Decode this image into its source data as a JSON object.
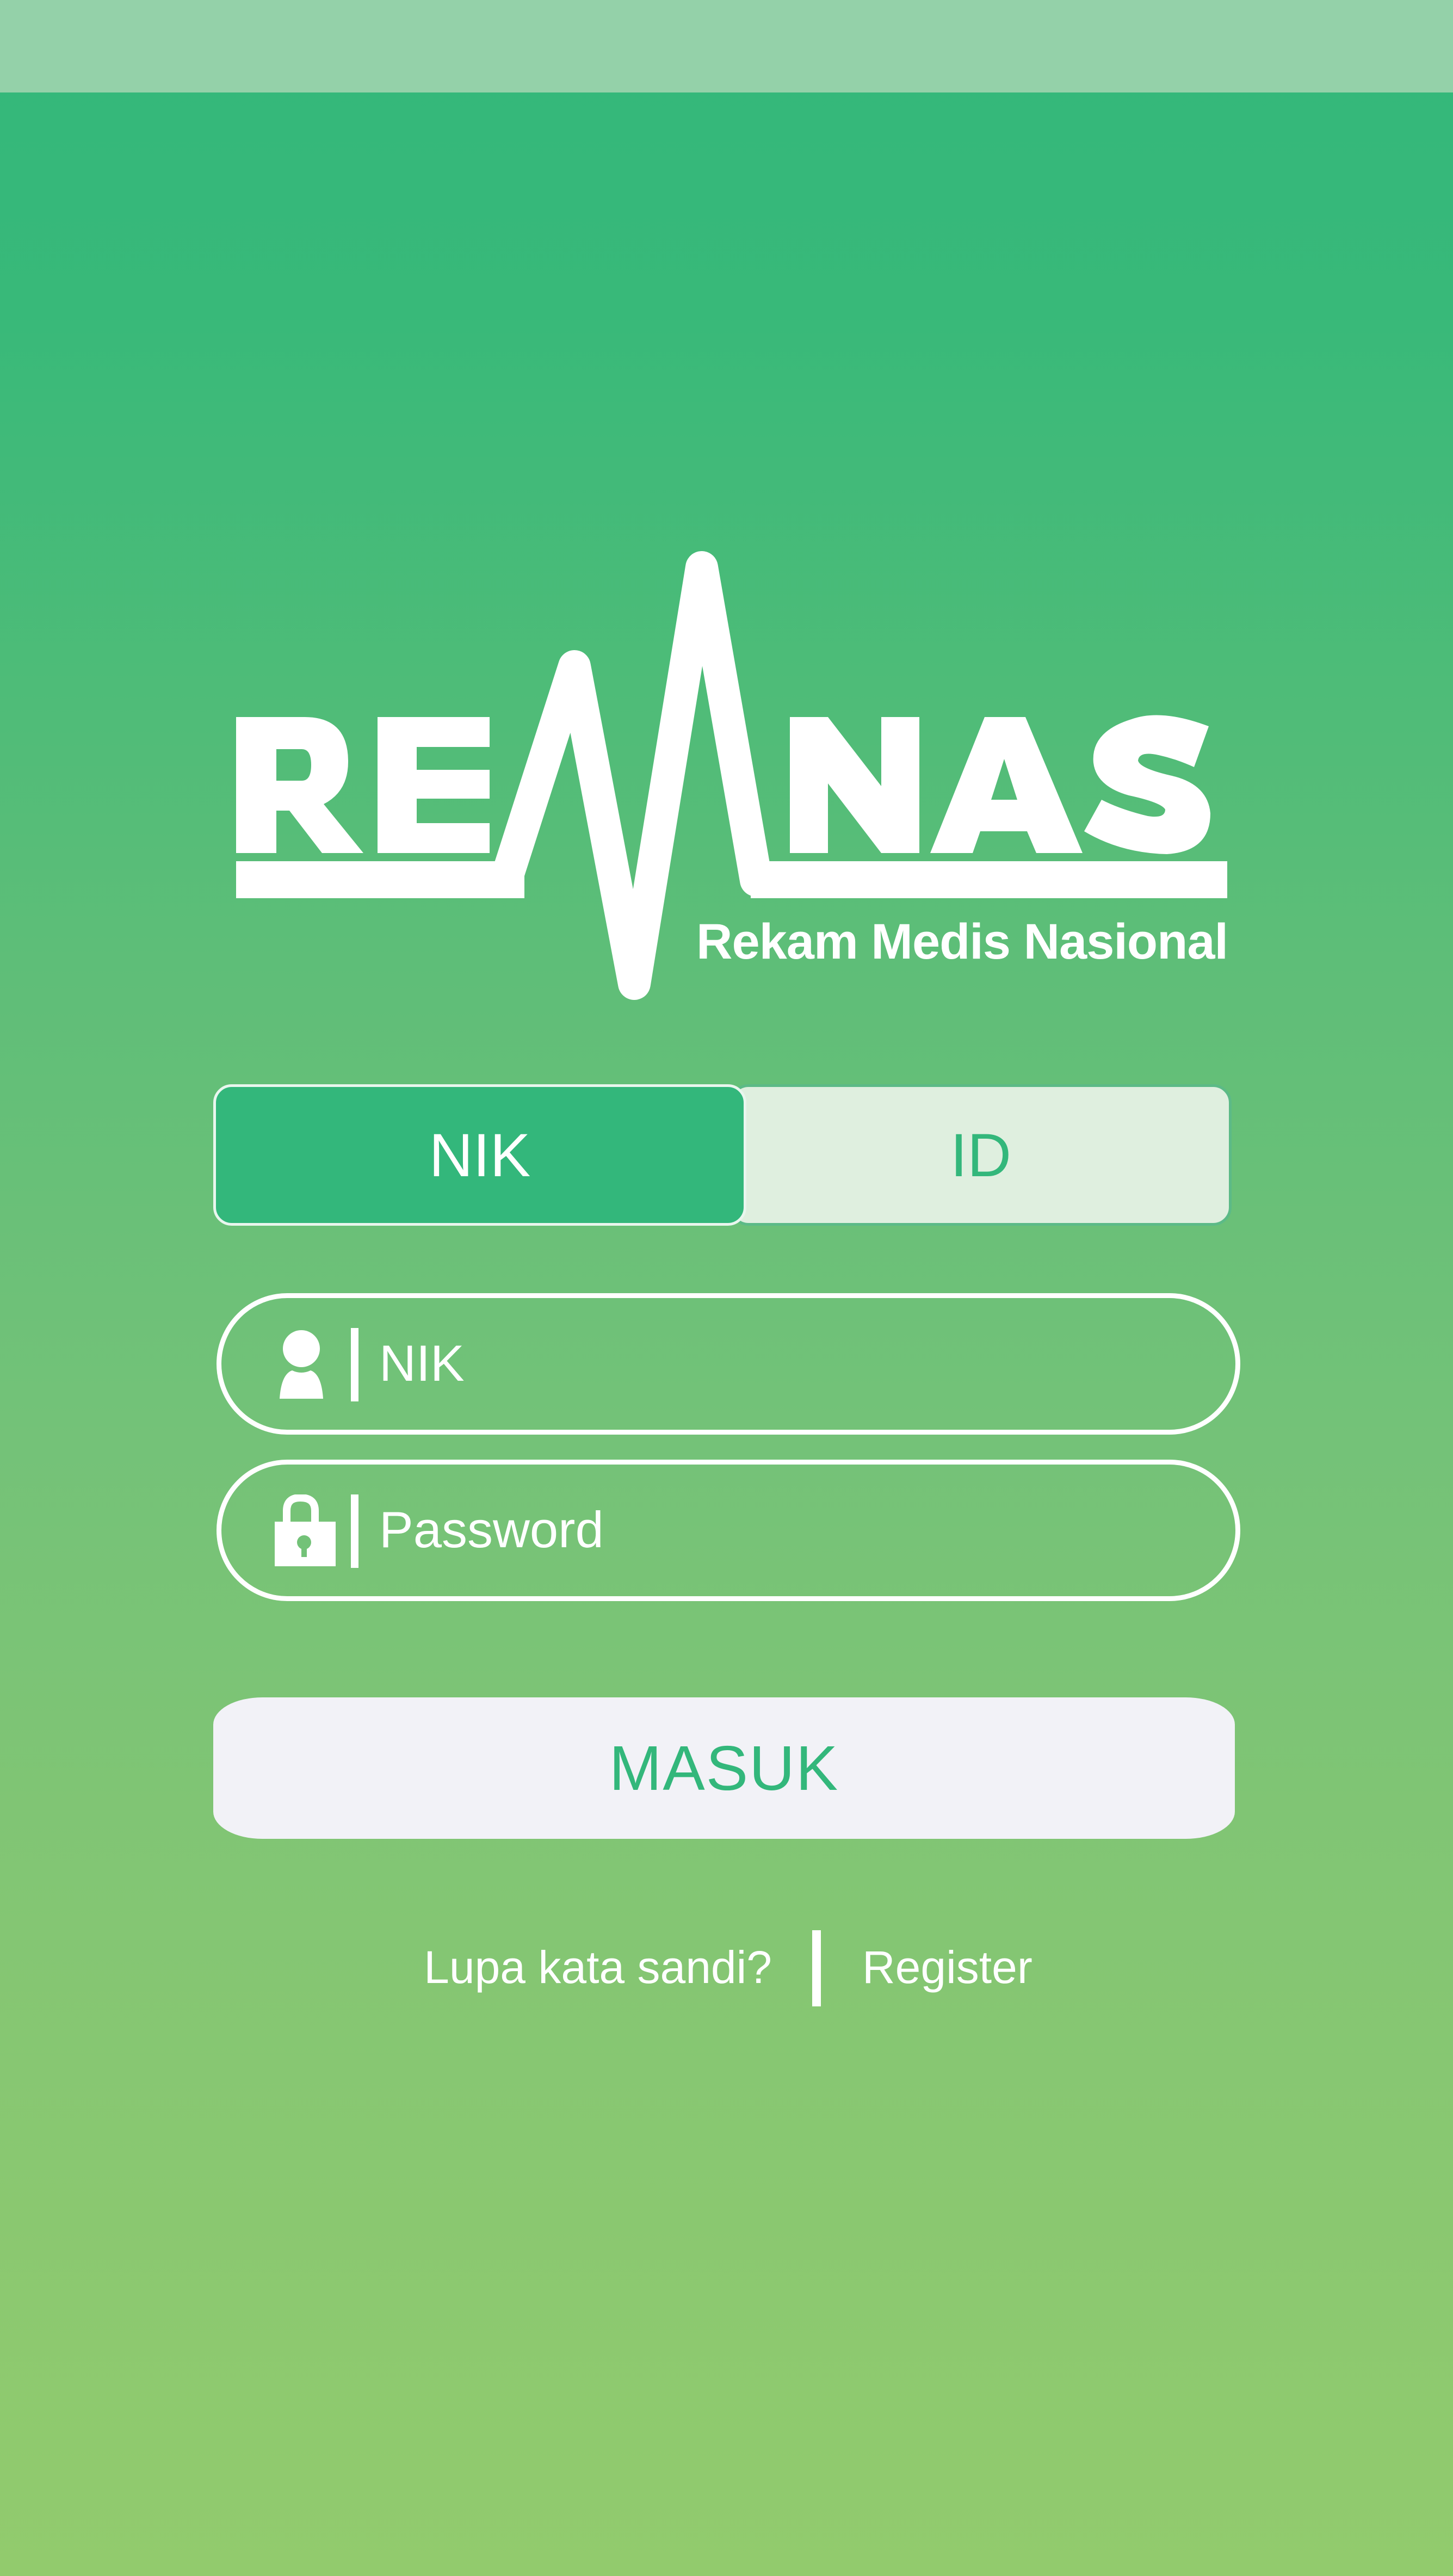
{
  "app": {
    "logo_wordmark": "REMNAS",
    "logo_tagline": "Rekam Medis Nasional"
  },
  "login_tabs": [
    {
      "label": "NIK",
      "selected": true
    },
    {
      "label": "ID",
      "selected": false
    }
  ],
  "form": {
    "nik_field": {
      "placeholder": "NIK",
      "value": "",
      "icon": "user-icon"
    },
    "password_field": {
      "placeholder": "Password",
      "value": "",
      "icon": "lock-icon"
    }
  },
  "submit_button": {
    "label": "MASUK"
  },
  "footer": {
    "forgot_password": "Lupa kata sandi?",
    "register": "Register"
  },
  "colors": {
    "primary_green": "#33b77b",
    "gradient_bottom": "#92cb6d",
    "tab_inactive_bg": "#dfefdf",
    "button_bg": "#f2f2f7",
    "status_bar": "#94d1a9"
  }
}
